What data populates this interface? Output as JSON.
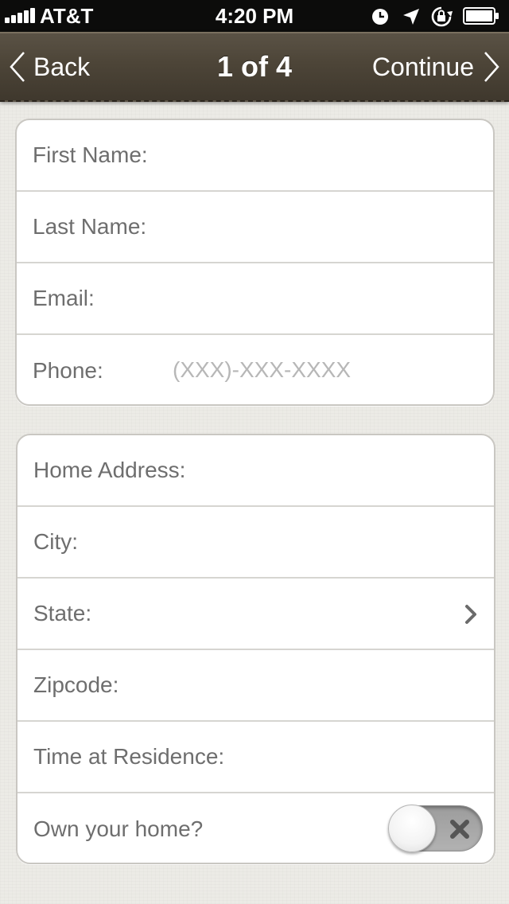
{
  "status_bar": {
    "carrier": "AT&T",
    "time": "4:20 PM",
    "icons": [
      "alarm-icon",
      "location-icon",
      "rotation-lock-icon",
      "battery-icon"
    ]
  },
  "nav": {
    "back_label": "Back",
    "title": "1 of 4",
    "continue_label": "Continue"
  },
  "contact_group": {
    "fields": [
      {
        "label": "First Name:",
        "value": "",
        "placeholder": ""
      },
      {
        "label": "Last Name:",
        "value": "",
        "placeholder": ""
      },
      {
        "label": "Email:",
        "value": "",
        "placeholder": ""
      },
      {
        "label": "Phone:",
        "value": "",
        "placeholder": "(XXX)-XXX-XXXX"
      }
    ]
  },
  "address_group": {
    "fields": [
      {
        "label": "Home Address:",
        "value": "",
        "placeholder": ""
      },
      {
        "label": "City:",
        "value": "",
        "placeholder": ""
      },
      {
        "label": "State:",
        "value": ""
      },
      {
        "label": "Zipcode:",
        "value": "",
        "placeholder": ""
      },
      {
        "label": "Time at Residence:",
        "value": "",
        "placeholder": ""
      },
      {
        "label": "Own your home?",
        "toggle_on": false
      }
    ]
  },
  "colors": {
    "nav_background": "#4d4538",
    "label_text": "#6e6e6e",
    "placeholder_text": "#b7b7b7",
    "page_background": "#ecebe6"
  }
}
